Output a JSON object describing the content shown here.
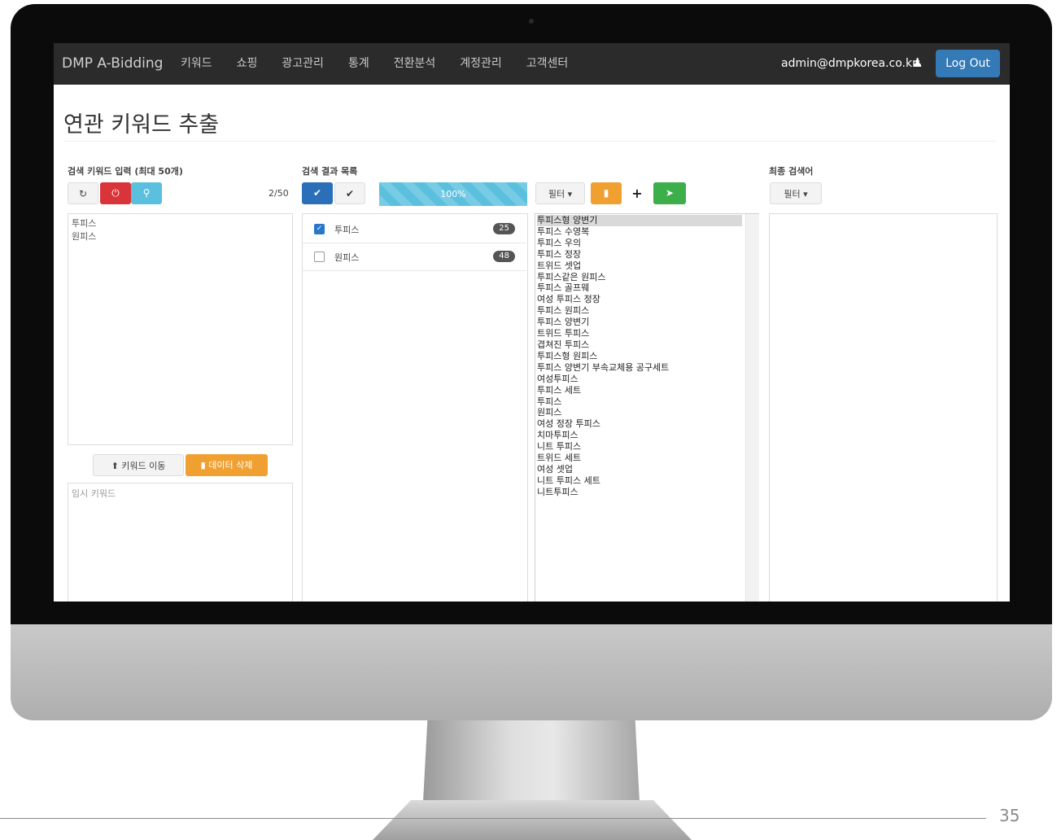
{
  "navbar": {
    "brand": "DMP A-Bidding",
    "menu": [
      "키워드",
      "쇼핑",
      "광고관리",
      "통계",
      "전환분석",
      "계정관리",
      "고객센터"
    ],
    "user_email": "admin@dmpkorea.co.kr",
    "logout_label": "Log Out"
  },
  "page": {
    "title": "연관 키워드 추출",
    "page_number": "35"
  },
  "input_panel": {
    "label": "검색 키워드 입력 (최대 50개)",
    "count": "2/50",
    "keywords": [
      "투피스",
      "원피스"
    ],
    "move_button": "키워드 이동",
    "delete_button": "데이터 삭제",
    "temp_placeholder": "임시 키워드"
  },
  "results_panel": {
    "label": "검색 결과 목록",
    "progress_text": "100%",
    "progress_value": 100,
    "rows": [
      {
        "label": "투피스",
        "count": "25",
        "checked": true
      },
      {
        "label": "원피스",
        "count": "48",
        "checked": false
      }
    ]
  },
  "related_panel": {
    "filter_label": "필터",
    "selected_index": 0,
    "items": [
      "투피스형 양변기",
      "투피스 수영복",
      "투피스 우의",
      "투피스 정장",
      "트위드 셋업",
      "투피스같은 원피스",
      "투피스 골프웨",
      "여성 투피스 정장",
      "투피스 원피스",
      "투피스 양변기",
      "트위드 투피스",
      "겹쳐진 투피스",
      "투피스형 원피스",
      "투피스 양변기 부속교체용 공구세트",
      "여성투피스",
      "투피스 세트",
      "투피스",
      "원피스",
      "여성 정장 투피스",
      "치마투피스",
      "니트 투피스",
      "트위드 세트",
      "여성 셋업",
      "니트 투피스 세트",
      "니트투피스"
    ]
  },
  "final_panel": {
    "label": "최종 검색어",
    "filter_label": "필터"
  },
  "colors": {
    "navbar": "#2b2b2b",
    "logout": "#337ab7",
    "danger": "#d9343a",
    "info": "#5bc0de",
    "primary": "#2a6fb8",
    "warning": "#f0a030",
    "success": "#3cae4a"
  }
}
